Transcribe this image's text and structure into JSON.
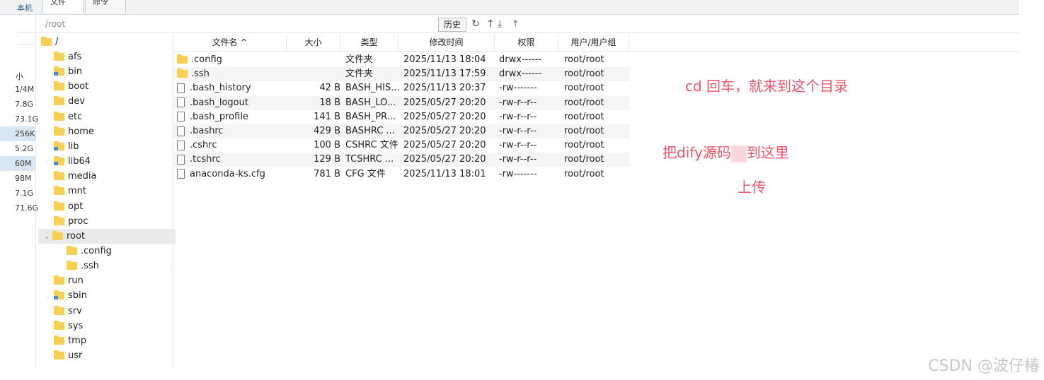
{
  "top_tabs": {
    "local": "本机",
    "tab1": "文件",
    "tab2": "命令"
  },
  "left_panel": {
    "label": "小",
    "sizes": [
      "1/4M",
      "7.8G",
      "73.1G",
      "256K",
      "5.2G",
      "60M",
      "98M",
      "7.1G",
      "71.6G"
    ]
  },
  "pathbar": {
    "path": "/root",
    "history_label": "历史"
  },
  "tree": {
    "root": "/",
    "items": [
      "afs",
      "bin",
      "boot",
      "dev",
      "etc",
      "home",
      "lib",
      "lib64",
      "media",
      "mnt",
      "opt",
      "proc",
      "root",
      ".config",
      ".ssh",
      "run",
      "sbin",
      "srv",
      "sys",
      "tmp",
      "usr"
    ]
  },
  "columns": [
    "文件名 ^",
    "大小",
    "类型",
    "修改时间",
    "权限",
    "用户/用户组"
  ],
  "files": [
    {
      "name": ".config",
      "size": "",
      "type": "文件夹",
      "mtime": "2025/11/13 18:04",
      "perm": "drwx------",
      "owner": "root/root"
    },
    {
      "name": ".ssh",
      "size": "",
      "type": "文件夹",
      "mtime": "2025/11/13 17:59",
      "perm": "drwx------",
      "owner": "root/root"
    },
    {
      "name": ".bash_history",
      "size": "42 B",
      "type": "BASH_HIS...",
      "mtime": "2025/11/13 20:37",
      "perm": "-rw-------",
      "owner": "root/root"
    },
    {
      "name": ".bash_logout",
      "size": "18 B",
      "type": "BASH_LO...",
      "mtime": "2025/05/27 20:20",
      "perm": "-rw-r--r--",
      "owner": "root/root"
    },
    {
      "name": ".bash_profile",
      "size": "141 B",
      "type": "BASH_PR...",
      "mtime": "2025/05/27 20:20",
      "perm": "-rw-r--r--",
      "owner": "root/root"
    },
    {
      "name": ".bashrc",
      "size": "429 B",
      "type": "BASHRC ...",
      "mtime": "2025/05/27 20:20",
      "perm": "-rw-r--r--",
      "owner": "root/root"
    },
    {
      "name": ".cshrc",
      "size": "100 B",
      "type": "CSHRC 文件",
      "mtime": "2025/05/27 20:20",
      "perm": "-rw-r--r--",
      "owner": "root/root"
    },
    {
      "name": ".tcshrc",
      "size": "129 B",
      "type": "TCSHRC ...",
      "mtime": "2025/05/27 20:20",
      "perm": "-rw-r--r--",
      "owner": "root/root"
    },
    {
      "name": "anaconda-ks.cfg",
      "size": "781 B",
      "type": "CFG 文件",
      "mtime": "2025/11/13 18:01",
      "perm": "-rw-------",
      "owner": "root/root"
    }
  ],
  "annotations": {
    "note1": "cd 回车，就来到这个目录",
    "note2_before": "把dify源码",
    "note2_after": "到这里",
    "note3": "上传"
  },
  "watermark": "CSDN @波仔椿"
}
